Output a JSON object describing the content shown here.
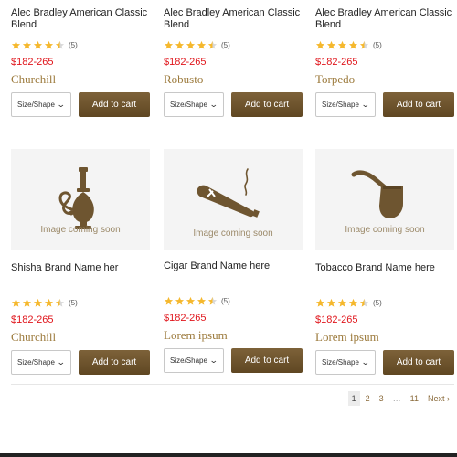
{
  "products_top": [
    {
      "title": "Alec Bradley American Classic Blend",
      "reviews": "(5)",
      "rating": 4.5,
      "price": "$182-265",
      "variant": "Churchill",
      "size_label": "Size/Shape",
      "cart_label": "Add to cart"
    },
    {
      "title": "Alec Bradley American Classic Blend",
      "reviews": "(5)",
      "rating": 4.5,
      "price": "$182-265",
      "variant": "Robusto",
      "size_label": "Size/Shape",
      "cart_label": "Add to cart"
    },
    {
      "title": "Alec Bradley American Classic Blend",
      "reviews": "(5)",
      "rating": 4.5,
      "price": "$182-265",
      "variant": "Torpedo",
      "size_label": "Size/Shape",
      "cart_label": "Add to cart"
    }
  ],
  "products_bottom": [
    {
      "image_text": "Image coming soon",
      "icon": "hookah-icon",
      "title": "Shisha Brand Name her",
      "reviews": "(5)",
      "rating": 4.5,
      "price": "$182-265",
      "variant": "Churchill",
      "size_label": "Size/Shape",
      "cart_label": "Add to cart"
    },
    {
      "image_text": "Image coming soon",
      "icon": "cigar-icon",
      "title": "Cigar Brand Name here",
      "reviews": "(5)",
      "rating": 4.5,
      "price": "$182-265",
      "variant": "Lorem ipsum",
      "size_label": "Size/Shape",
      "cart_label": "Add to cart"
    },
    {
      "image_text": "Image coming soon",
      "icon": "pipe-icon",
      "title": "Tobacco Brand Name here",
      "reviews": "(5)",
      "rating": 4.5,
      "price": "$182-265",
      "variant": "Lorem ipsum",
      "size_label": "Size/Shape",
      "cart_label": "Add to cart"
    }
  ],
  "pagination": {
    "pages": [
      "1",
      "2",
      "3",
      "…",
      "11"
    ],
    "current": "1",
    "next_label": "Next",
    "next_icon": "chevron-right-icon"
  },
  "colors": {
    "accent_brown": "#6e5530",
    "price_red": "#e0161c",
    "variant_gold": "#9c7a3c",
    "star_gold": "#f5b82e"
  }
}
